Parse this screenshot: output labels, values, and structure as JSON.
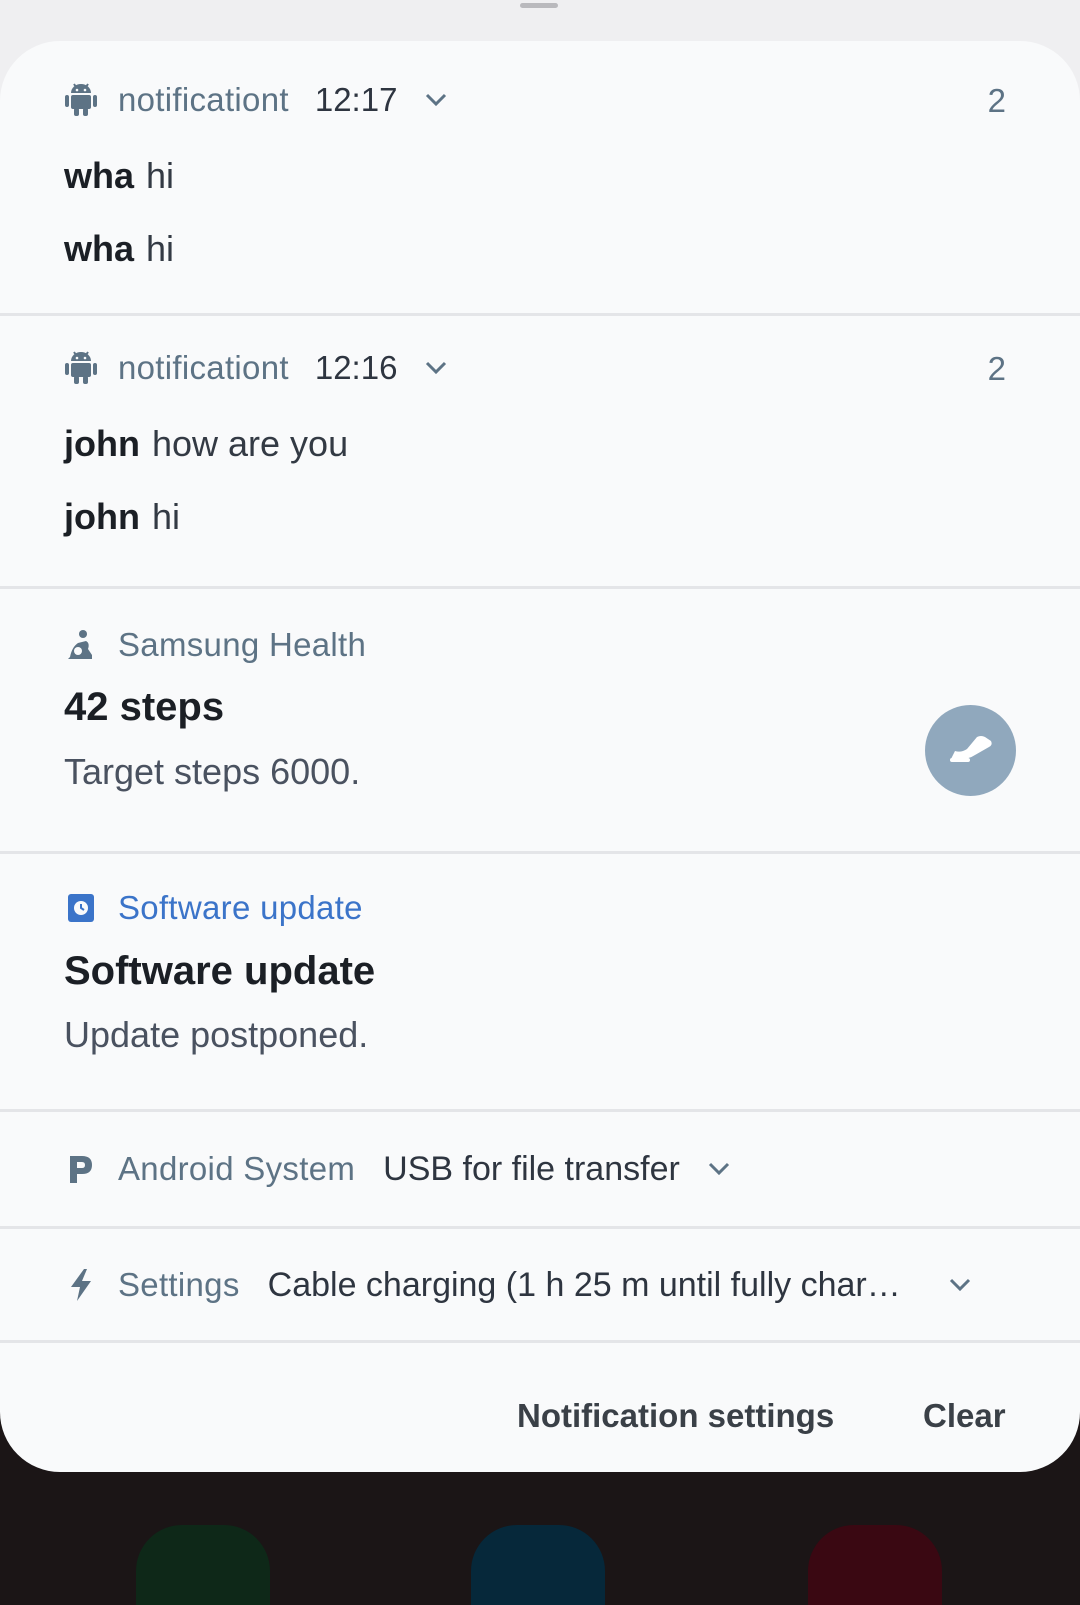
{
  "notifications": [
    {
      "app": "notificationt",
      "time": "12:17",
      "count": "2",
      "icon": "android-icon",
      "messages": [
        {
          "sender": "wha",
          "text": "hi"
        },
        {
          "sender": "wha",
          "text": "hi"
        }
      ]
    },
    {
      "app": "notificationt",
      "time": "12:16",
      "count": "2",
      "icon": "android-icon",
      "messages": [
        {
          "sender": "john",
          "text": "how are you"
        },
        {
          "sender": "john",
          "text": "hi"
        }
      ]
    }
  ],
  "health": {
    "app": "Samsung Health",
    "icon": "samsung-health-icon",
    "title": "42 steps",
    "subtitle": "Target steps 6000.",
    "action_icon": "shoe-icon"
  },
  "software_update": {
    "app": "Software update",
    "icon": "software-update-icon",
    "title": "Software update",
    "subtitle": "Update postponed."
  },
  "android_system": {
    "app": "Android System",
    "icon": "android-system-icon",
    "description": "USB for file transfer"
  },
  "settings_notif": {
    "app": "Settings",
    "icon": "lightning-icon",
    "description": "Cable charging (1 h 25 m until fully char…"
  },
  "footer": {
    "notification_settings": "Notification settings",
    "clear": "Clear"
  },
  "colors": {
    "panel": "#f9fafb",
    "app_name": "#5d7385",
    "accent_blue": "#3b74c9",
    "shoe_button": "#90a8bd"
  }
}
